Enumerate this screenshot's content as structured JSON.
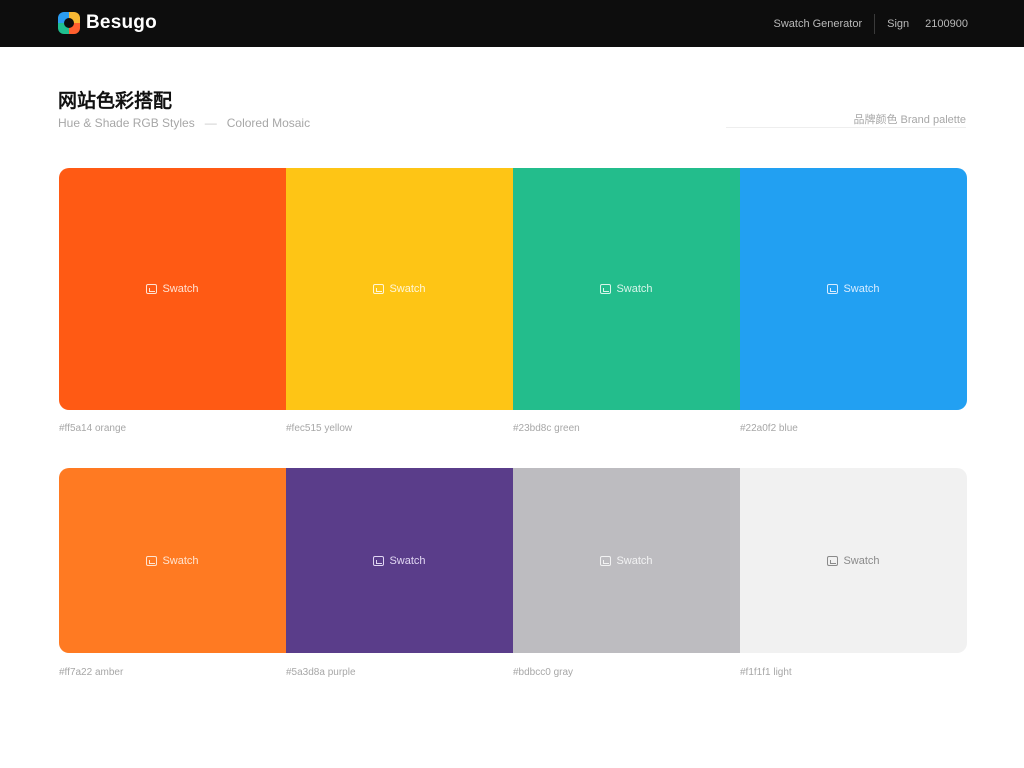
{
  "app": {
    "name": "Besugo"
  },
  "nav": {
    "item1": "Swatch Generator",
    "item2": "Sign",
    "item3": "2100900"
  },
  "header": {
    "title": "网站色彩搭配",
    "subtitle_left": "Hue & Shade RGB Styles",
    "subtitle_dash": "—",
    "subtitle_right": "Colored Mosaic",
    "meta_right": "品牌颜色 Brand palette"
  },
  "palette": {
    "row1": [
      {
        "label": "Swatch",
        "color": "#ff5a14",
        "text_color": "#ffe2d3",
        "caption": "#ff5a14 orange"
      },
      {
        "label": "Swatch",
        "color": "#fec515",
        "text_color": "#fff6d7",
        "caption": "#fec515 yellow"
      },
      {
        "label": "Swatch",
        "color": "#23bd8c",
        "text_color": "#d7f5ea",
        "caption": "#23bd8c green"
      },
      {
        "label": "Swatch",
        "color": "#22a0f2",
        "text_color": "#d8ecff",
        "caption": "#22a0f2 blue"
      }
    ],
    "row2": [
      {
        "label": "Swatch",
        "color": "#ff7a22",
        "text_color": "#ffe4d0",
        "caption": "#ff7a22 amber"
      },
      {
        "label": "Swatch",
        "color": "#5a3d8a",
        "text_color": "#e0d6f2",
        "caption": "#5a3d8a purple"
      },
      {
        "label": "Swatch",
        "color": "#bdbcc0",
        "text_color": "#f2f2f3",
        "caption": "#bdbcc0 gray"
      },
      {
        "label": "Swatch",
        "color": "#f1f1f1",
        "text_color": "#8a8a8a",
        "caption": "#f1f1f1 light"
      }
    ]
  }
}
